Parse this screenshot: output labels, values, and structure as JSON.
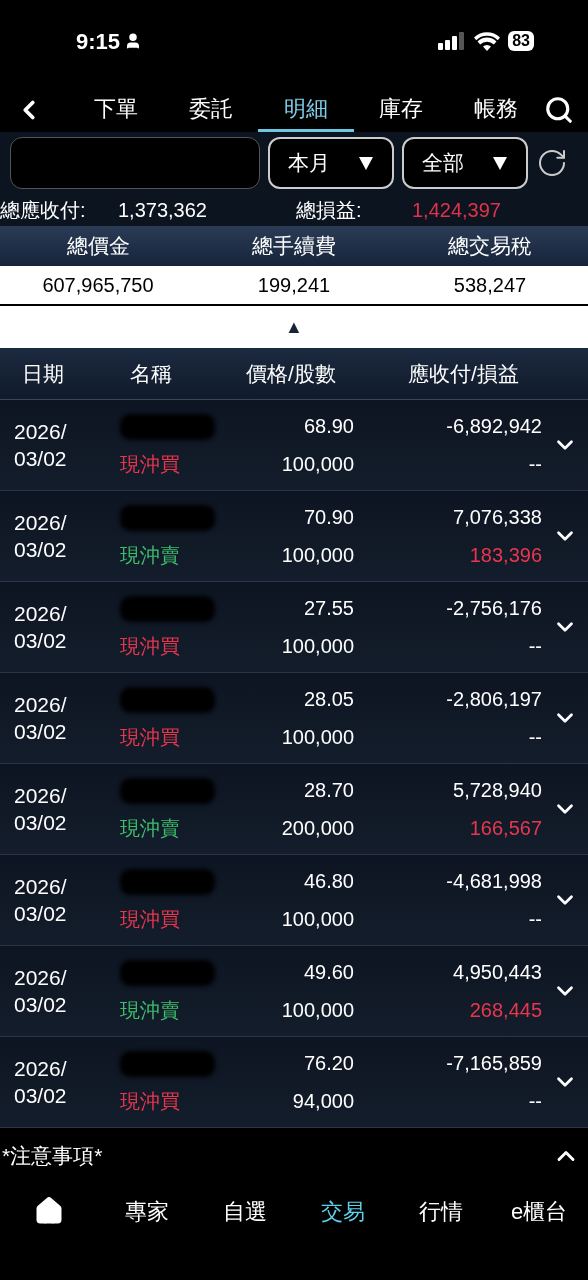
{
  "status_bar": {
    "time": "9:15",
    "battery": "83"
  },
  "tabs": [
    {
      "label": "下單",
      "selected": false
    },
    {
      "label": "委託",
      "selected": false
    },
    {
      "label": "明細",
      "selected": true
    },
    {
      "label": "庫存",
      "selected": false
    },
    {
      "label": "帳務",
      "selected": false
    }
  ],
  "filters": [
    {
      "value": "本月"
    },
    {
      "value": "全部"
    }
  ],
  "summary": {
    "receivable_label": "總應收付:",
    "receivable": "1,373,362",
    "pl_label": "總損益:",
    "pl": "1,424,397"
  },
  "totals": {
    "columns": [
      "總價金",
      "總手續費",
      "總交易稅"
    ],
    "values": [
      "607,965,750",
      "199,241",
      "538,247"
    ],
    "toggle": "▲"
  },
  "table": {
    "columns": [
      "日期",
      "名稱",
      "價格/股數",
      "應收付/損益"
    ],
    "rows": [
      {
        "date": "2026/\n03/02",
        "kind": "buy",
        "type": "現沖買",
        "price": "68.90",
        "shares": "100,000",
        "amount": "-6,892,942",
        "pl": "--"
      },
      {
        "date": "2026/\n03/02",
        "kind": "sell",
        "type": "現沖賣",
        "price": "70.90",
        "shares": "100,000",
        "amount": "7,076,338",
        "pl": "183,396"
      },
      {
        "date": "2026/\n03/02",
        "kind": "buy",
        "type": "現沖買",
        "price": "27.55",
        "shares": "100,000",
        "amount": "-2,756,176",
        "pl": "--"
      },
      {
        "date": "2026/\n03/02",
        "kind": "buy",
        "type": "現沖買",
        "price": "28.05",
        "shares": "100,000",
        "amount": "-2,806,197",
        "pl": "--"
      },
      {
        "date": "2026/\n03/02",
        "kind": "sell",
        "type": "現沖賣",
        "price": "28.70",
        "shares": "200,000",
        "amount": "5,728,940",
        "pl": "166,567"
      },
      {
        "date": "2026/\n03/02",
        "kind": "buy",
        "type": "現沖買",
        "price": "46.80",
        "shares": "100,000",
        "amount": "-4,681,998",
        "pl": "--"
      },
      {
        "date": "2026/\n03/02",
        "kind": "sell",
        "type": "現沖賣",
        "price": "49.60",
        "shares": "100,000",
        "amount": "4,950,443",
        "pl": "268,445"
      },
      {
        "date": "2026/\n03/02",
        "kind": "buy",
        "type": "現沖買",
        "price": "76.20",
        "shares": "94,000",
        "amount": "-7,165,859",
        "pl": "--"
      }
    ]
  },
  "notice": {
    "label": "*注意事項*"
  },
  "bottom_nav": [
    {
      "kind": "home",
      "selected": false
    },
    {
      "label": "專家",
      "selected": false
    },
    {
      "label": "自選",
      "selected": false
    },
    {
      "label": "交易",
      "selected": true
    },
    {
      "label": "行情",
      "selected": false
    },
    {
      "label": "e櫃台",
      "selected": false
    }
  ]
}
